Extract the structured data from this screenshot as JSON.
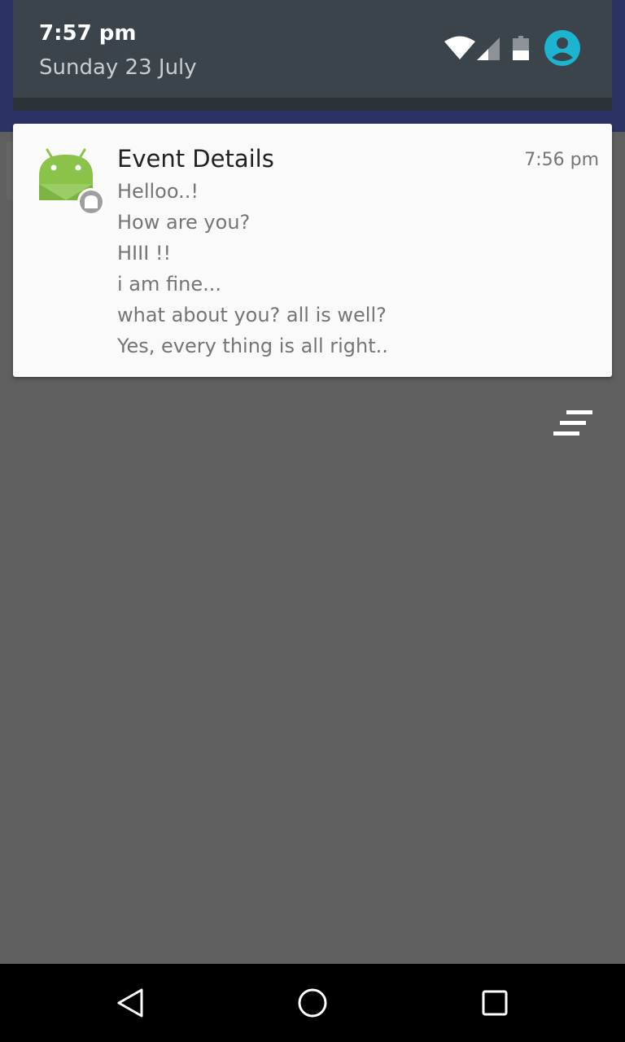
{
  "status_header": {
    "time": "7:57 pm",
    "date": "Sunday 23 July",
    "icons": [
      "wifi-icon",
      "cell-signal-icon",
      "battery-icon",
      "account-icon"
    ],
    "accent_color": "#1cb5d1"
  },
  "notification": {
    "app_icon": "android-app-icon",
    "badge_icon": "android-badge-icon",
    "title": "Event Details",
    "time": "7:56 pm",
    "lines": [
      "Helloo..!",
      "How are you?",
      "HIII !!",
      "i am fine...",
      "what about you? all is well?",
      "Yes, every thing is all right.."
    ]
  },
  "actions": {
    "clear_all_icon": "clear-all-icon"
  },
  "nav_bar": {
    "buttons": [
      "back-icon",
      "home-icon",
      "recents-icon"
    ]
  },
  "colors": {
    "scrim": "#5f5f5f",
    "header": "#3b434b",
    "card": "#fafafa",
    "android_green": "#8bc34a"
  }
}
